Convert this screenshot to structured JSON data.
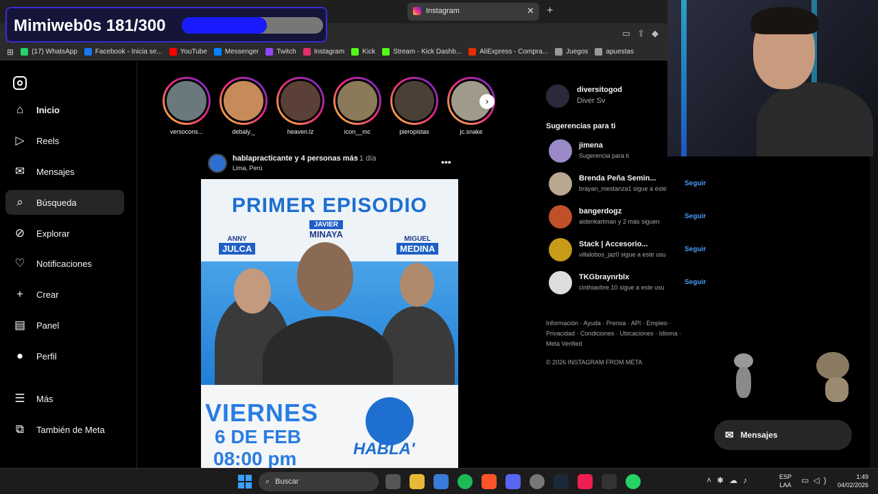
{
  "browser": {
    "active_tab": "Instagram",
    "bookmarks": [
      {
        "label": "(17) WhatsApp",
        "color": "#25d366"
      },
      {
        "label": "Facebook - Inicia se...",
        "color": "#1877f2"
      },
      {
        "label": "YouTube",
        "color": "#ff0000"
      },
      {
        "label": "Messenger",
        "color": "#0084ff"
      },
      {
        "label": "Twitch",
        "color": "#9146ff"
      },
      {
        "label": "Instagram",
        "color": "#e1306c"
      },
      {
        "label": "Kick",
        "color": "#53fc18"
      },
      {
        "label": "Stream - Kick Dashb...",
        "color": "#53fc18"
      },
      {
        "label": "AliExpress - Compra...",
        "color": "#e62e04"
      },
      {
        "label": "Juegos",
        "color": "#999999"
      },
      {
        "label": "apuestas",
        "color": "#999999"
      }
    ]
  },
  "overlay": {
    "text": "Mimiweb0s 181/300",
    "progress": 0.6
  },
  "sidebar": {
    "items": [
      {
        "label": "Inicio",
        "icon": "home-icon",
        "glyph": "⌂"
      },
      {
        "label": "Reels",
        "icon": "reels-icon",
        "glyph": "▷"
      },
      {
        "label": "Mensajes",
        "icon": "messages-icon",
        "glyph": "✉"
      },
      {
        "label": "Búsqueda",
        "icon": "search-icon",
        "glyph": "⌕"
      },
      {
        "label": "Explorar",
        "icon": "explore-icon",
        "glyph": "⊘"
      },
      {
        "label": "Notificaciones",
        "icon": "heart-icon",
        "glyph": "♡"
      },
      {
        "label": "Crear",
        "icon": "plus-icon",
        "glyph": "+"
      },
      {
        "label": "Panel",
        "icon": "panel-icon",
        "glyph": "▤"
      },
      {
        "label": "Perfil",
        "icon": "profile-icon",
        "glyph": "●"
      }
    ],
    "more": "Más",
    "meta": "También de Meta"
  },
  "stories": [
    {
      "name": "versocons...",
      "color": "#6a7a7c"
    },
    {
      "name": "debaly._",
      "color": "#c98a5a"
    },
    {
      "name": "heaven.lz",
      "color": "#5a4036"
    },
    {
      "name": "icon__mc",
      "color": "#8a7a5a"
    },
    {
      "name": "pieropistas",
      "color": "#4a4036"
    },
    {
      "name": "jc.snake",
      "color": "#a09a8a"
    }
  ],
  "post": {
    "author": "hablapracticante y 4 personas más",
    "time": "• 1 día",
    "location": "Lima, Perú",
    "poster": {
      "title": "PRIMER EPISODIO",
      "guest_center_first": "JAVIER",
      "guest_center_last": "MINAYA",
      "guest_left_first": "ANNY",
      "guest_left_last": "JULCA",
      "guest_right_first": "MIGUEL",
      "guest_right_last": "MEDINA",
      "day": "VIERNES",
      "date": "6 DE FEB",
      "hour": "08:00 pm",
      "brand": "HABLA'"
    }
  },
  "account": {
    "username": "diversitogod",
    "name": "Diver Sv"
  },
  "suggestions_title": "Sugerencias para ti",
  "suggestions": [
    {
      "name": "jimena",
      "sub": "Sugerencia para ti",
      "follow": "",
      "color": "#9a8ac8"
    },
    {
      "name": "Brenda Peña Semin...",
      "sub": "brayan_mestanza1 sigue a este",
      "follow": "Seguir",
      "color": "#b8a890"
    },
    {
      "name": "bangerdogz",
      "sub": "aidenkartman y 2 más siguen",
      "follow": "Seguir",
      "color": "#c0502a"
    },
    {
      "name": "Stack | Accesorio...",
      "sub": "villalobos_jaz0 sigue a este usu",
      "follow": "Seguir",
      "color": "#c89a1a"
    },
    {
      "name": "TKGbraynrblx",
      "sub": "cinthiaobre.10 sigue a este usu",
      "follow": "Seguir",
      "color": "#dddddd"
    }
  ],
  "footer": {
    "links": "Información · Ayuda · Prensa · API · Empleo · Privacidad · Condiciones · Ubicaciones · Idioma · Meta Verified",
    "copyright": "© 2026 INSTAGRAM FROM META"
  },
  "messages_pill": "Mensajes",
  "taskbar": {
    "search_placeholder": "Buscar",
    "lang_1": "ESP",
    "lang_2": "LAA",
    "time": "1:49",
    "date": "04/02/2026"
  }
}
